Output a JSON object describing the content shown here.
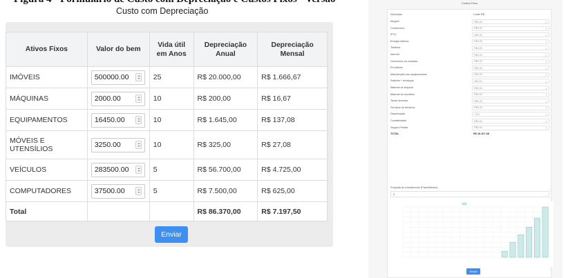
{
  "document": {
    "caption": "Figura 4 - Formulário de Custo com Depreciação e Custos Fixos - Versão"
  },
  "left": {
    "title": "Custo com Depreciação",
    "headers": [
      "Ativos Fixos",
      "Valor do bem",
      "Vida útil em Anos",
      "Depreciação Anual",
      "Depreciação Mensal"
    ],
    "rows": [
      {
        "asset": "IMÓVEIS",
        "value": "500000.00",
        "life": "25",
        "annual": "R$ 20.000,00",
        "monthly": "R$ 1.666,67"
      },
      {
        "asset": "MÁQUINAS",
        "value": "2000.00",
        "life": "10",
        "annual": "R$ 200,00",
        "monthly": "R$ 16,67"
      },
      {
        "asset": "EQUIPAMENTOS",
        "value": "16450.00",
        "life": "10",
        "annual": "R$ 1.645,00",
        "monthly": "R$ 137,08"
      },
      {
        "asset": "MÓVEIS E UTENSÍLIOS",
        "value": "3250.00",
        "life": "10",
        "annual": "R$ 325,00",
        "monthly": "R$ 27,08"
      },
      {
        "asset": "VEÍCULOS",
        "value": "283500.00",
        "life": "5",
        "annual": "R$ 56.700,00",
        "monthly": "R$ 4.725,00"
      },
      {
        "asset": "COMPUTADORES",
        "value": "37500.00",
        "life": "5",
        "annual": "R$ 7.500,00",
        "monthly": "R$ 625,00"
      }
    ],
    "total": {
      "label": "Total",
      "annual": "R$ 86.370,00",
      "monthly": "R$ 7.197,50"
    },
    "submit_label": "Enviar"
  },
  "right": {
    "title": "Custos Fixos",
    "headers": [
      "Descrição",
      "Custo R$"
    ],
    "rows": [
      {
        "label": "Aluguel",
        "value": "R$0,00"
      },
      {
        "label": "Condomínio",
        "value": "R$0,00"
      },
      {
        "label": "IPTU",
        "value": "R$0,00"
      },
      {
        "label": "Energia elétrica",
        "value": "R$0,00"
      },
      {
        "label": "Telefone",
        "value": "R$0,00"
      },
      {
        "label": "Internet",
        "value": "R$0,00"
      },
      {
        "label": "Honorários do contador",
        "value": "R$0,00"
      },
      {
        "label": "Pró-labore",
        "value": "R$0,00"
      },
      {
        "label": "Manutenção dos equipamentos",
        "value": "R$0,00"
      },
      {
        "label": "Salários + encargos",
        "value": "480,00"
      },
      {
        "label": "Material de limpeza",
        "value": "R$0,00"
      },
      {
        "label": "Material de escritório",
        "value": "R$0,00"
      },
      {
        "label": "Taxas diversas",
        "value": "R$0,00"
      },
      {
        "label": "Serviços de terceiros",
        "value": "R$0,00"
      },
      {
        "label": "Depreciação",
        "value": "7197"
      },
      {
        "label": "Contabilidade",
        "value": "R$0,00"
      },
      {
        "label": "Seguro Predial",
        "value": "R$0,00"
      }
    ],
    "total": {
      "label": "TOTAL",
      "value": "R$ 18.107,08"
    },
    "projection_label": "Projeção do Investimento (Prazo/Meses)",
    "projection_value": "0",
    "submit_label": "Enviar"
  },
  "chart_data": {
    "type": "bar",
    "series": [
      {
        "values": [
          0,
          0,
          0,
          0,
          0,
          0,
          0,
          0,
          0,
          0,
          0,
          0,
          0.12,
          0.3,
          0.45,
          0.6,
          0.78,
          1.0
        ]
      }
    ],
    "categories": [
      "",
      "",
      "",
      "",
      "",
      "",
      "",
      "",
      "",
      "",
      "",
      "",
      "",
      "",
      "",
      "",
      "",
      ""
    ],
    "ylim": [
      0,
      1
    ],
    "grid": true,
    "bar_color": "#cdeae8",
    "bar_stroke": "#7cc5bf"
  }
}
